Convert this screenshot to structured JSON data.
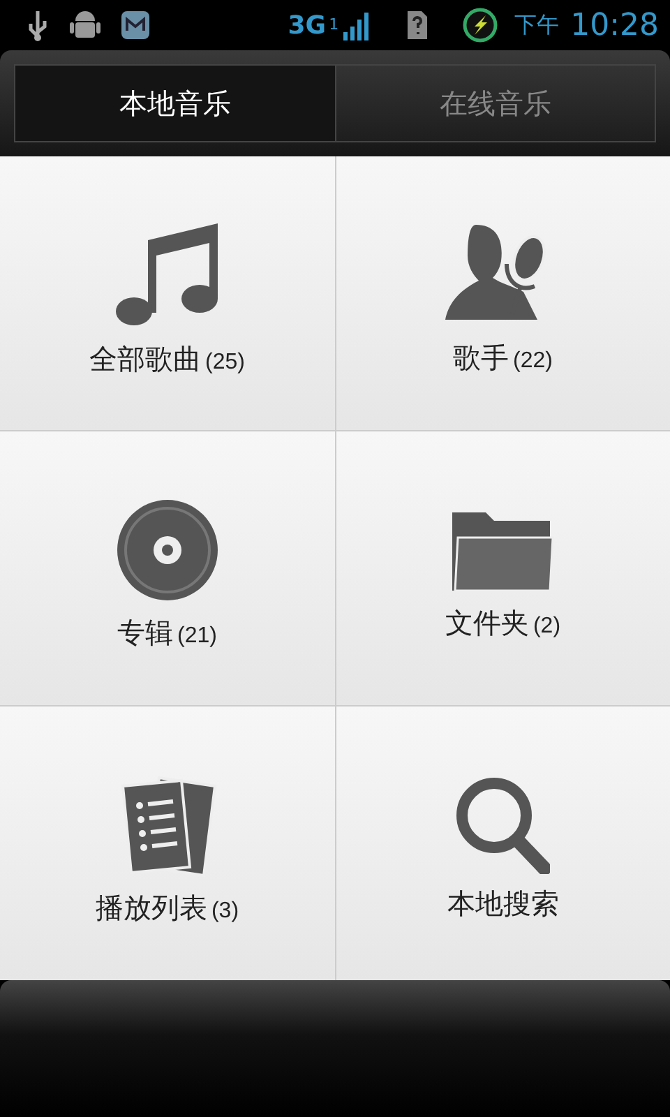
{
  "status_bar": {
    "network": "3G",
    "sim_slot": "1",
    "period": "下午",
    "time": "10:28"
  },
  "tabs": [
    {
      "label": "本地音乐",
      "selected": true
    },
    {
      "label": "在线音乐",
      "selected": false
    }
  ],
  "tiles": [
    {
      "kind": "songs",
      "label": "全部歌曲",
      "count": "(25)"
    },
    {
      "kind": "artists",
      "label": "歌手",
      "count": "(22)"
    },
    {
      "kind": "albums",
      "label": "专辑",
      "count": "(21)"
    },
    {
      "kind": "folders",
      "label": "文件夹",
      "count": "(2)"
    },
    {
      "kind": "playlists",
      "label": "播放列表",
      "count": "(3)"
    },
    {
      "kind": "search",
      "label": "本地搜索"
    }
  ]
}
